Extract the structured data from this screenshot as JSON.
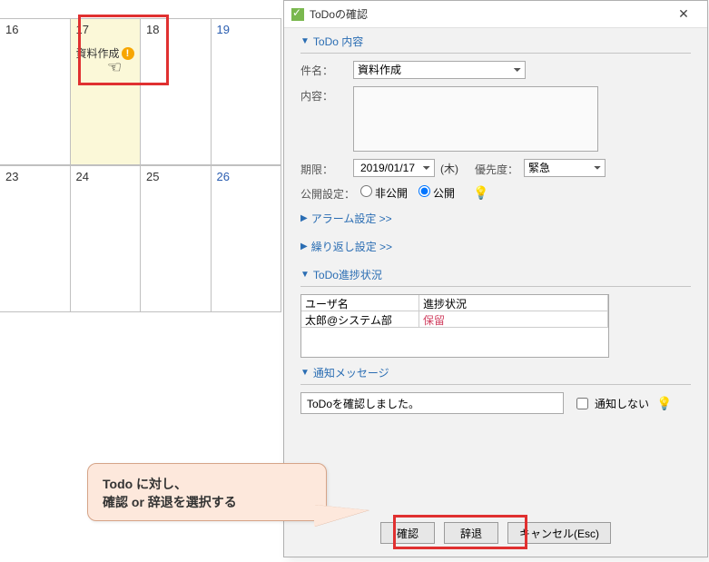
{
  "calendar": {
    "cells": [
      [
        "16",
        "17",
        "18",
        "19"
      ],
      [
        "23",
        "24",
        "25",
        "26"
      ]
    ],
    "event_label": "資料作成"
  },
  "dialog": {
    "title": "ToDoの確認",
    "content_section": "ToDo 内容",
    "labels": {
      "subject": "件名：",
      "content": "内容：",
      "deadline": "期限：",
      "priority": "優先度：",
      "visibility": "公開設定："
    },
    "subject_value": "資料作成",
    "deadline_value": "2019/01/17",
    "day_of_week": "(木)",
    "priority_value": "緊急",
    "visibility": {
      "private": "非公開",
      "public": "公開"
    },
    "alarm_link": "アラーム設定 >>",
    "repeat_link": "繰り返し設定 >>",
    "progress_section": "ToDo進捗状況",
    "progress_headers": {
      "user": "ユーザ名",
      "status": "進捗状況"
    },
    "progress": [
      {
        "user": "太郎@システム部",
        "status": "保留"
      }
    ],
    "message_section": "通知メッセージ",
    "message_value": "ToDoを確認しました。",
    "no_notify": "通知しない",
    "buttons": {
      "confirm": "確認",
      "decline": "辞退",
      "cancel": "キャンセル(Esc)"
    }
  },
  "callout": {
    "line1": "Todo に対し、",
    "line2": "確認 or 辞退を選択する"
  }
}
